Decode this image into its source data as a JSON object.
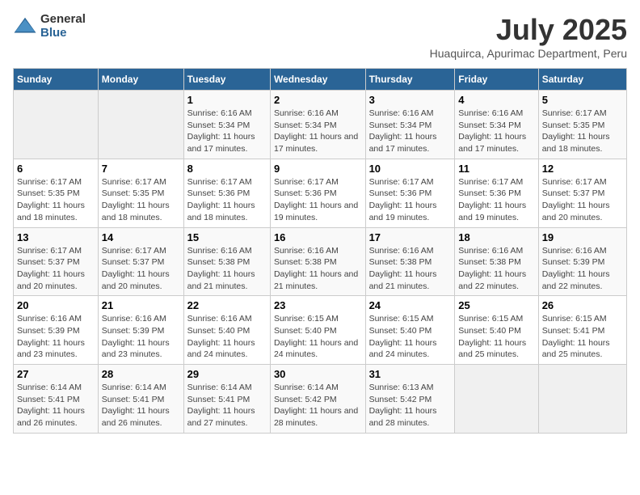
{
  "logo": {
    "general": "General",
    "blue": "Blue"
  },
  "title": "July 2025",
  "location": "Huaquirca, Apurimac Department, Peru",
  "days_header": [
    "Sunday",
    "Monday",
    "Tuesday",
    "Wednesday",
    "Thursday",
    "Friday",
    "Saturday"
  ],
  "weeks": [
    [
      {
        "day": "",
        "info": ""
      },
      {
        "day": "",
        "info": ""
      },
      {
        "day": "1",
        "info": "Sunrise: 6:16 AM\nSunset: 5:34 PM\nDaylight: 11 hours and 17 minutes."
      },
      {
        "day": "2",
        "info": "Sunrise: 6:16 AM\nSunset: 5:34 PM\nDaylight: 11 hours and 17 minutes."
      },
      {
        "day": "3",
        "info": "Sunrise: 6:16 AM\nSunset: 5:34 PM\nDaylight: 11 hours and 17 minutes."
      },
      {
        "day": "4",
        "info": "Sunrise: 6:16 AM\nSunset: 5:34 PM\nDaylight: 11 hours and 17 minutes."
      },
      {
        "day": "5",
        "info": "Sunrise: 6:17 AM\nSunset: 5:35 PM\nDaylight: 11 hours and 18 minutes."
      }
    ],
    [
      {
        "day": "6",
        "info": "Sunrise: 6:17 AM\nSunset: 5:35 PM\nDaylight: 11 hours and 18 minutes."
      },
      {
        "day": "7",
        "info": "Sunrise: 6:17 AM\nSunset: 5:35 PM\nDaylight: 11 hours and 18 minutes."
      },
      {
        "day": "8",
        "info": "Sunrise: 6:17 AM\nSunset: 5:36 PM\nDaylight: 11 hours and 18 minutes."
      },
      {
        "day": "9",
        "info": "Sunrise: 6:17 AM\nSunset: 5:36 PM\nDaylight: 11 hours and 19 minutes."
      },
      {
        "day": "10",
        "info": "Sunrise: 6:17 AM\nSunset: 5:36 PM\nDaylight: 11 hours and 19 minutes."
      },
      {
        "day": "11",
        "info": "Sunrise: 6:17 AM\nSunset: 5:36 PM\nDaylight: 11 hours and 19 minutes."
      },
      {
        "day": "12",
        "info": "Sunrise: 6:17 AM\nSunset: 5:37 PM\nDaylight: 11 hours and 20 minutes."
      }
    ],
    [
      {
        "day": "13",
        "info": "Sunrise: 6:17 AM\nSunset: 5:37 PM\nDaylight: 11 hours and 20 minutes."
      },
      {
        "day": "14",
        "info": "Sunrise: 6:17 AM\nSunset: 5:37 PM\nDaylight: 11 hours and 20 minutes."
      },
      {
        "day": "15",
        "info": "Sunrise: 6:16 AM\nSunset: 5:38 PM\nDaylight: 11 hours and 21 minutes."
      },
      {
        "day": "16",
        "info": "Sunrise: 6:16 AM\nSunset: 5:38 PM\nDaylight: 11 hours and 21 minutes."
      },
      {
        "day": "17",
        "info": "Sunrise: 6:16 AM\nSunset: 5:38 PM\nDaylight: 11 hours and 21 minutes."
      },
      {
        "day": "18",
        "info": "Sunrise: 6:16 AM\nSunset: 5:38 PM\nDaylight: 11 hours and 22 minutes."
      },
      {
        "day": "19",
        "info": "Sunrise: 6:16 AM\nSunset: 5:39 PM\nDaylight: 11 hours and 22 minutes."
      }
    ],
    [
      {
        "day": "20",
        "info": "Sunrise: 6:16 AM\nSunset: 5:39 PM\nDaylight: 11 hours and 23 minutes."
      },
      {
        "day": "21",
        "info": "Sunrise: 6:16 AM\nSunset: 5:39 PM\nDaylight: 11 hours and 23 minutes."
      },
      {
        "day": "22",
        "info": "Sunrise: 6:16 AM\nSunset: 5:40 PM\nDaylight: 11 hours and 24 minutes."
      },
      {
        "day": "23",
        "info": "Sunrise: 6:15 AM\nSunset: 5:40 PM\nDaylight: 11 hours and 24 minutes."
      },
      {
        "day": "24",
        "info": "Sunrise: 6:15 AM\nSunset: 5:40 PM\nDaylight: 11 hours and 24 minutes."
      },
      {
        "day": "25",
        "info": "Sunrise: 6:15 AM\nSunset: 5:40 PM\nDaylight: 11 hours and 25 minutes."
      },
      {
        "day": "26",
        "info": "Sunrise: 6:15 AM\nSunset: 5:41 PM\nDaylight: 11 hours and 25 minutes."
      }
    ],
    [
      {
        "day": "27",
        "info": "Sunrise: 6:14 AM\nSunset: 5:41 PM\nDaylight: 11 hours and 26 minutes."
      },
      {
        "day": "28",
        "info": "Sunrise: 6:14 AM\nSunset: 5:41 PM\nDaylight: 11 hours and 26 minutes."
      },
      {
        "day": "29",
        "info": "Sunrise: 6:14 AM\nSunset: 5:41 PM\nDaylight: 11 hours and 27 minutes."
      },
      {
        "day": "30",
        "info": "Sunrise: 6:14 AM\nSunset: 5:42 PM\nDaylight: 11 hours and 28 minutes."
      },
      {
        "day": "31",
        "info": "Sunrise: 6:13 AM\nSunset: 5:42 PM\nDaylight: 11 hours and 28 minutes."
      },
      {
        "day": "",
        "info": ""
      },
      {
        "day": "",
        "info": ""
      }
    ]
  ]
}
